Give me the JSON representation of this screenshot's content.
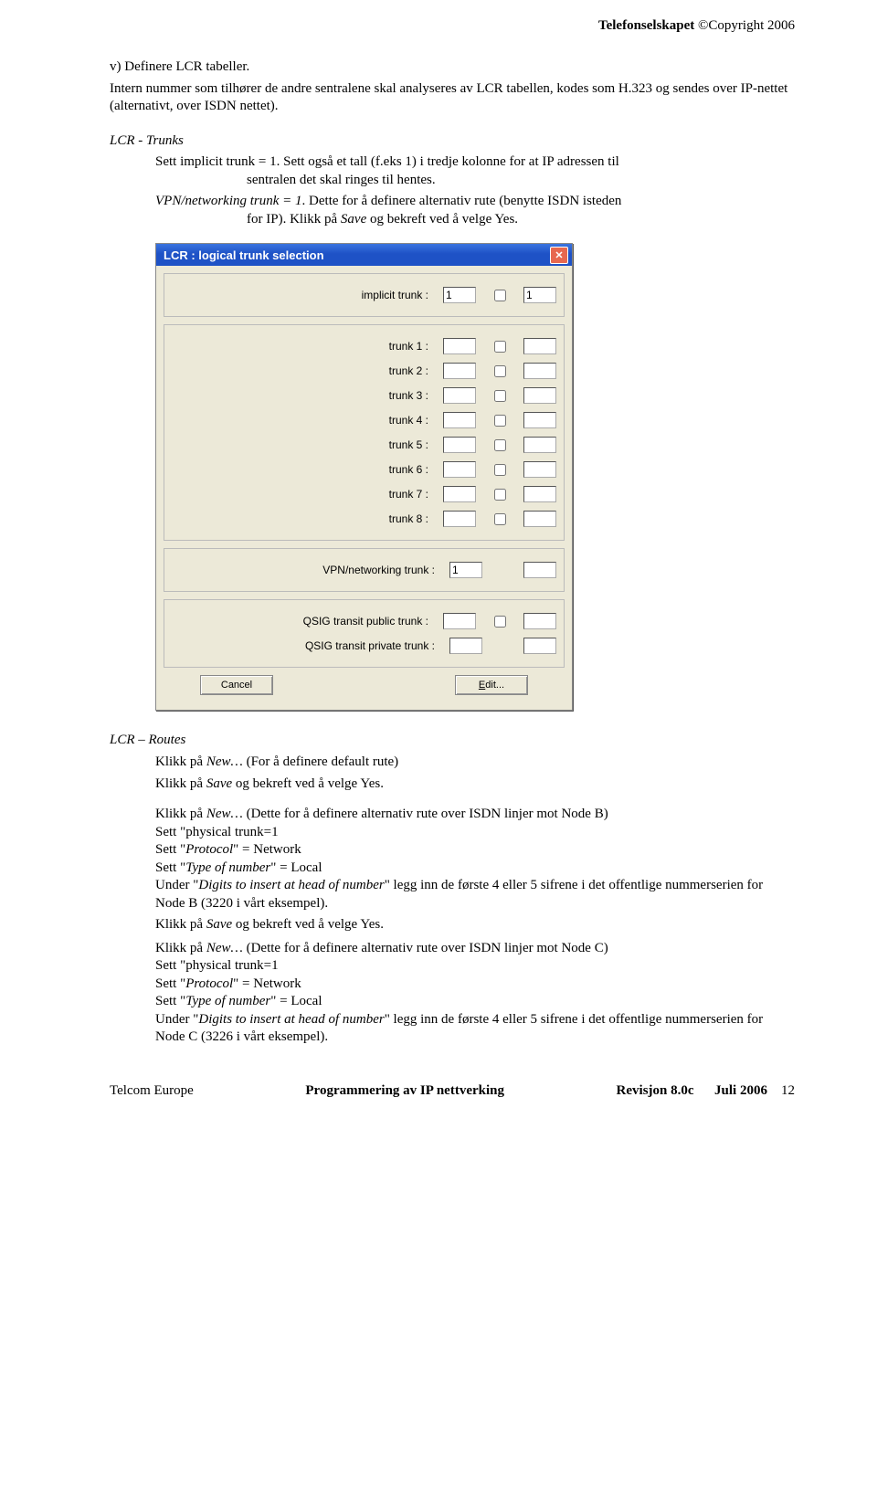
{
  "header": {
    "brand": "Telefonselskapet",
    "copyright": " ©Copyright 2006"
  },
  "body": {
    "v_title": "v) Definere LCR tabeller.",
    "v_para1a": "Intern nummer som tilhører de andre sentralene skal analyseres av LCR tabellen, kodes som H.323 og sendes over IP-nettet (alternativt, over ISDN nettet).",
    "lcr_trunks_title": "LCR  - Trunks",
    "lcr_trunks_p1": "Sett implicit trunk  = 1.   Sett også et tall (f.eks 1) i tredje kolonne for at IP adressen til",
    "lcr_trunks_p1b": "sentralen det skal ringes til hentes.",
    "lcr_trunks_p2": "VPN/networking trunk = 1. Dette for å definere alternativ rute (benytte ISDN isteden",
    "lcr_trunks_p2b": "for IP). Klikk på Save og bekreft ved å velge Yes.",
    "lcr_routes_title": "LCR – Routes",
    "routes_p1": "Klikk på  New… (For å definere default rute)",
    "routes_p2": "Klikk på Save og bekreft ved å velge Yes.",
    "routes_p3": "Klikk på New… (Dette for å definere alternativ rute over ISDN linjer mot Node B)",
    "routes_p4": "Sett \"physical trunk=1",
    "routes_p5a": "Sett \"",
    "routes_p5b": "Protocol",
    "routes_p5c": "\" = Network",
    "routes_p6a": "Sett \"",
    "routes_p6b": "Type of number",
    "routes_p6c": "\" = Local",
    "routes_p7a": "Under \"",
    "routes_p7b": "Digits to insert at head of number",
    "routes_p7c": "\" legg inn de første 4 eller 5 sifrene i det offentlige nummerserien for Node B (3220 i vårt eksempel).",
    "routes_p8": "Klikk på Save og bekreft ved å velge Yes.",
    "routes_p9": "Klikk på New… (Dette for å definere alternativ rute over ISDN linjer mot Node C)",
    "routes_p10": "Sett \"physical trunk=1",
    "routes_p11c": "\" legg inn de første 4 eller 5 sifrene i det offentlige nummerserien for Node C (3226 i vårt eksempel)."
  },
  "dialog": {
    "title": "LCR : logical trunk selection",
    "implicit_label": "implicit trunk :",
    "implicit_a": "1",
    "implicit_b": "1",
    "trunks": [
      {
        "label": "trunk 1 :"
      },
      {
        "label": "trunk 2 :"
      },
      {
        "label": "trunk 3 :"
      },
      {
        "label": "trunk 4 :"
      },
      {
        "label": "trunk 5 :"
      },
      {
        "label": "trunk 6 :"
      },
      {
        "label": "trunk 7 :"
      },
      {
        "label": "trunk 8 :"
      }
    ],
    "vpn_label": "VPN/networking trunk :",
    "vpn_val": "1",
    "qsig_pub": "QSIG transit public trunk :",
    "qsig_priv": "QSIG transit private trunk :",
    "btn_cancel": "Cancel",
    "btn_edit_u": "E",
    "btn_edit_rest": "dit..."
  },
  "footer": {
    "left": "Telcom Europe",
    "center": "Programmering av IP nettverking",
    "rev": "Revisjon 8.0c",
    "date": "Juli 2006",
    "page": "12"
  }
}
